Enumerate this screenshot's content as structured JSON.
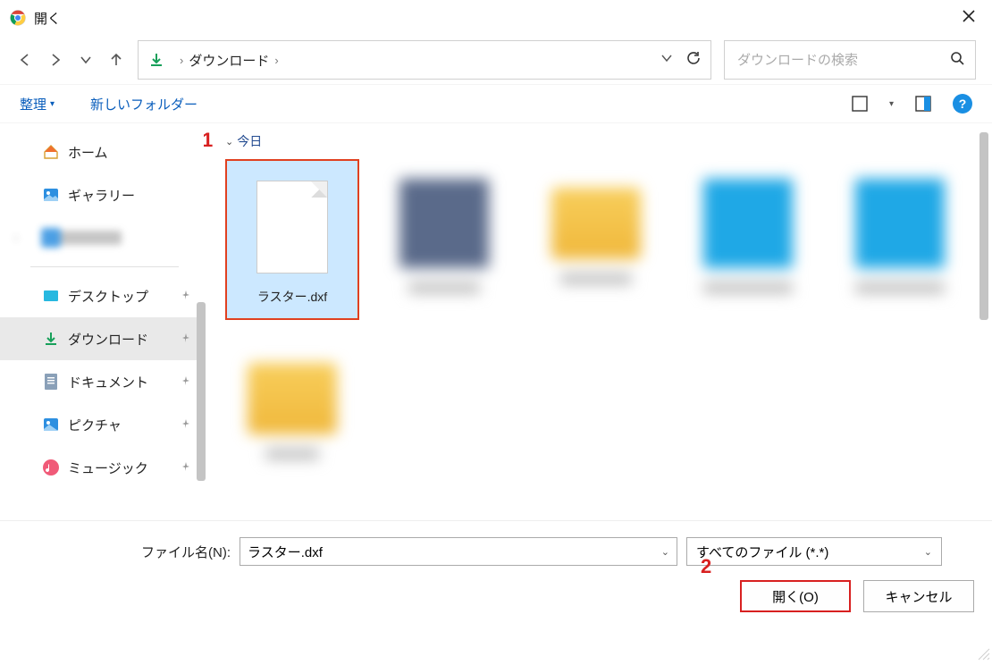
{
  "window": {
    "title": "開く"
  },
  "nav": {
    "breadcrumb": "ダウンロード"
  },
  "search": {
    "placeholder": "ダウンロードの検索"
  },
  "toolbar": {
    "organize": "整理",
    "new_folder": "新しいフォルダー"
  },
  "sidebar": {
    "home": "ホーム",
    "gallery": "ギャラリー",
    "blurred": " ",
    "desktop": "デスクトップ",
    "downloads": "ダウンロード",
    "documents": "ドキュメント",
    "pictures": "ピクチャ",
    "music": "ミュージック"
  },
  "content": {
    "section": "今日",
    "selected_file": "ラスター.dxf"
  },
  "bottom": {
    "filename_label": "ファイル名(N):",
    "filename_value": "ラスター.dxf",
    "filter_value": "すべてのファイル (*.*)",
    "open_label": "開く(O)",
    "cancel_label": "キャンセル"
  },
  "annotations": {
    "one": "1",
    "two": "2"
  }
}
